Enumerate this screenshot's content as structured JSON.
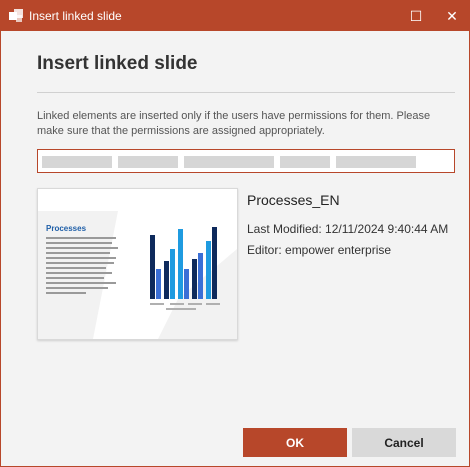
{
  "window": {
    "title": "Insert linked slide",
    "icon": "powerpoint-app-icon",
    "maximize_glyph": "☐",
    "close_glyph": "✕"
  },
  "dialog": {
    "heading": "Insert linked slide",
    "description": "Linked elements are inserted only if the users have permissions for them. Please make sure that the permissions are assigned appropriately."
  },
  "slide": {
    "name": "Processes_EN",
    "last_modified": "Last Modified: 12/11/2024 9:40:44 AM",
    "editor": "Editor: empower enterprise",
    "thumbnail": {
      "heading": "Processes",
      "bar_colors": [
        "#0e2a5c",
        "#1f9be0",
        "#3b6fd6"
      ]
    }
  },
  "buttons": {
    "ok": "OK",
    "cancel": "Cancel"
  },
  "colors": {
    "accent": "#b7472a",
    "background": "#f3f3f3",
    "cancel_bg": "#d9d9d9"
  }
}
